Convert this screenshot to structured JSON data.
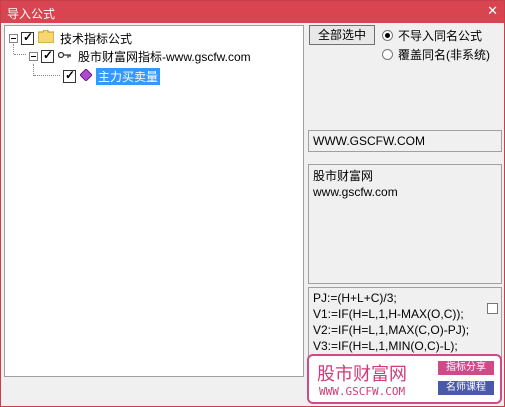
{
  "window": {
    "title": "导入公式",
    "close_label": "✕"
  },
  "tree": {
    "root": {
      "label": "技术指标公式",
      "checked": true
    },
    "child": {
      "label": "股市财富网指标-www.gscfw.com",
      "checked": true
    },
    "leaf": {
      "label": "主力买卖量",
      "checked": true,
      "selected": true
    }
  },
  "controls": {
    "select_all_button": "全部选中",
    "radio_skip_same": "不导入同名公式",
    "radio_overwrite": "覆盖同名(非系统)",
    "radio_selected": "skip"
  },
  "info": {
    "url_line": "WWW.GSCFW.COM",
    "description_lines": [
      "股市财富网",
      "www.gscfw.com"
    ]
  },
  "formula": {
    "lines": [
      "PJ:=(H+L+C)/3;",
      "V1:=IF(H=L,1,H-MAX(O,C));",
      "V2:=IF(H=L,1,MAX(C,O)-PJ);",
      "V3:=IF(H=L,1,MIN(O,C)-L);"
    ]
  },
  "watermark": {
    "name": "股市财富网",
    "url": "WWW.GSCFW.COM",
    "tag1": "指标分享",
    "tag2": "名师课程"
  },
  "colors": {
    "titlebar": "#d8444f",
    "selection": "#3399ff",
    "watermark": "#d23a7a"
  }
}
